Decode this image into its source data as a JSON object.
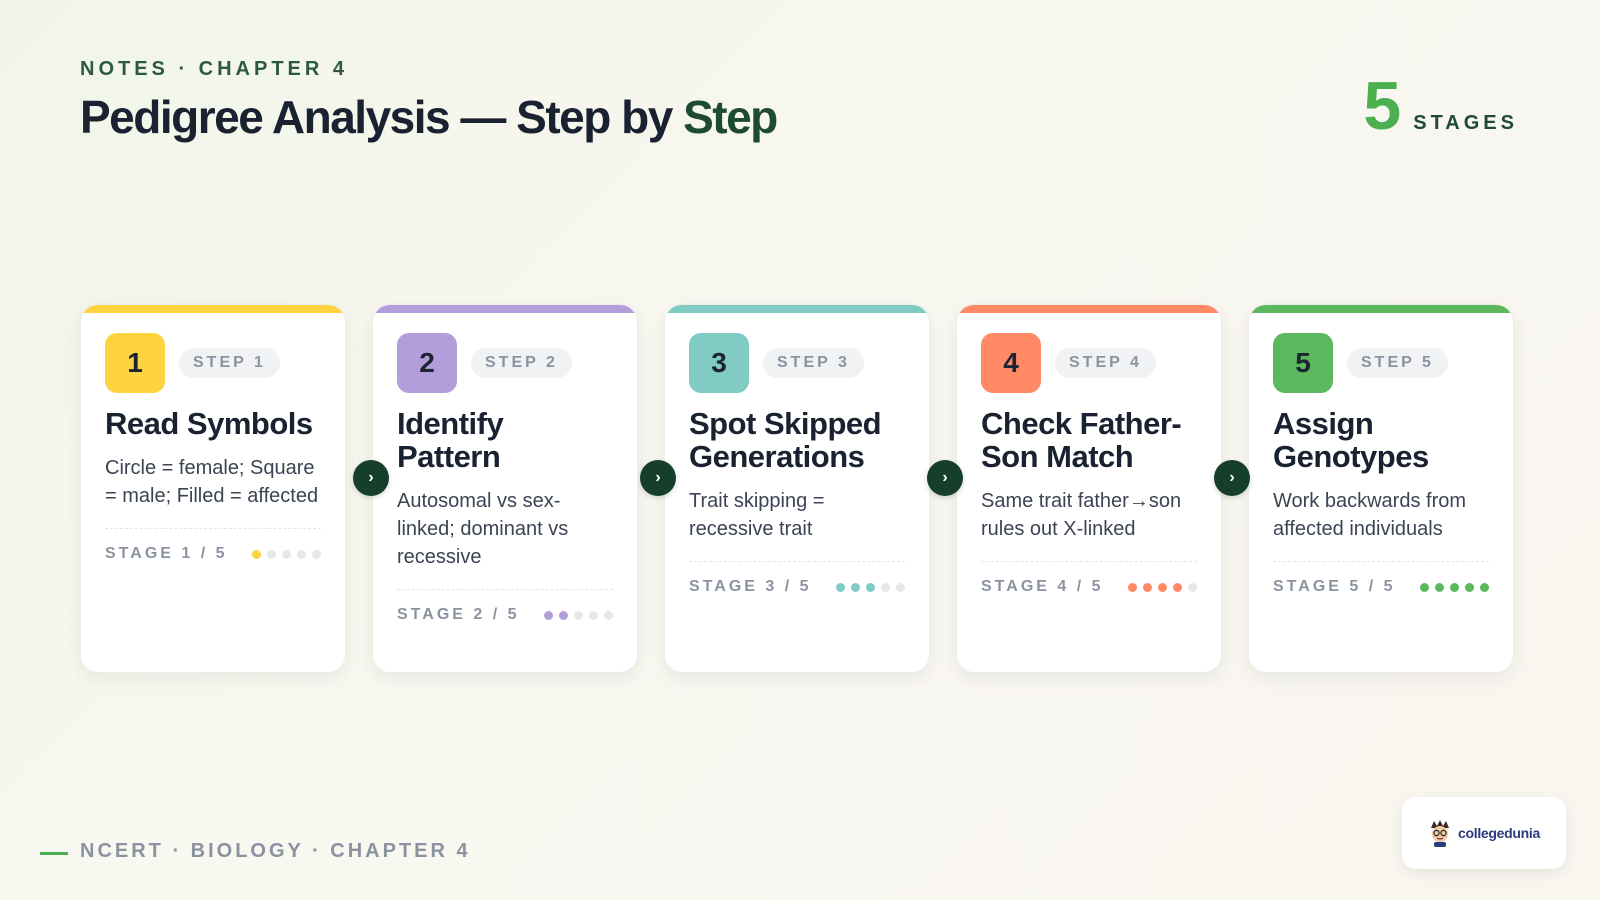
{
  "header": {
    "eyebrow": "NOTES · CHAPTER 4",
    "title_main": "Pedigree Analysis — Step by ",
    "title_accent": "Step",
    "stages_count": "5",
    "stages_label": "STAGES"
  },
  "steps": [
    {
      "number": "1",
      "step_label": "STEP 1",
      "title": "Read Symbols",
      "description": "Circle = female; Square = male; Filled = affected",
      "stage_text": "STAGE 1 / 5",
      "progress": 1,
      "color": "#fdd43f"
    },
    {
      "number": "2",
      "step_label": "STEP 2",
      "title": "Identify Pattern",
      "description": "Autosomal vs sex-linked; dominant vs recessive",
      "stage_text": "STAGE 2 / 5",
      "progress": 2,
      "color": "#b39ddb"
    },
    {
      "number": "3",
      "step_label": "STEP 3",
      "title": "Spot Skipped Generations",
      "description": "Trait skipping = recessive trait",
      "stage_text": "STAGE 3 / 5",
      "progress": 3,
      "color": "#80cbc4"
    },
    {
      "number": "4",
      "step_label": "STEP 4",
      "title": "Check Father-Son Match",
      "description": "Same trait father→son rules out X-linked",
      "stage_text": "STAGE 4 / 5",
      "progress": 4,
      "color": "#ff8a65"
    },
    {
      "number": "5",
      "step_label": "STEP 5",
      "title": "Assign Genotypes",
      "description": "Work backwards from affected individuals",
      "stage_text": "STAGE 5 / 5",
      "progress": 5,
      "color": "#5cb85c"
    }
  ],
  "total_stages": 5,
  "arrow_icon": "chevron-right-icon",
  "footer": {
    "text": "NCERT · BIOLOGY · CHAPTER 4",
    "logo_text": "collegedunia"
  }
}
